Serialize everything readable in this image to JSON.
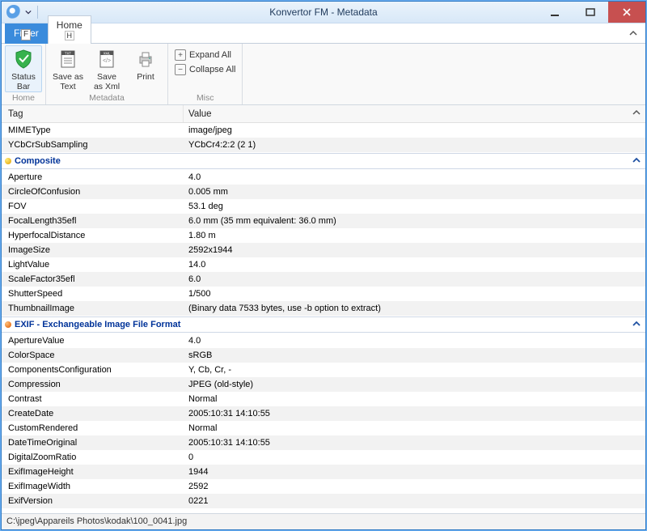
{
  "window": {
    "title": "Konvertor FM - Metadata"
  },
  "ribbon": {
    "tabs": {
      "file": "File",
      "home": "Home",
      "home_key": "H"
    },
    "buttons": {
      "status_bar": "Status\nBar",
      "save_text": "Save as\nText",
      "save_xml": "Save\nas Xml",
      "print": "Print",
      "expand_all": "Expand All",
      "collapse_all": "Collapse All"
    },
    "groups": {
      "home": "Home",
      "metadata": "Metadata",
      "misc": "Misc"
    }
  },
  "grid": {
    "headers": {
      "tag": "Tag",
      "value": "Value"
    },
    "lead_rows": [
      {
        "tag": "MIMEType",
        "value": "image/jpeg"
      },
      {
        "tag": "YCbCrSubSampling",
        "value": "YCbCr4:2:2 (2 1)"
      }
    ],
    "sections": [
      {
        "title": "Composite",
        "icon": "yellow",
        "rows": [
          {
            "tag": "Aperture",
            "value": "4.0"
          },
          {
            "tag": "CircleOfConfusion",
            "value": "0.005 mm"
          },
          {
            "tag": "FOV",
            "value": "53.1 deg"
          },
          {
            "tag": "FocalLength35efl",
            "value": "6.0 mm (35 mm equivalent: 36.0 mm)"
          },
          {
            "tag": "HyperfocalDistance",
            "value": "1.80 m"
          },
          {
            "tag": "ImageSize",
            "value": "2592x1944"
          },
          {
            "tag": "LightValue",
            "value": "14.0"
          },
          {
            "tag": "ScaleFactor35efl",
            "value": "6.0"
          },
          {
            "tag": "ShutterSpeed",
            "value": "1/500"
          },
          {
            "tag": "ThumbnailImage",
            "value": "(Binary data 7533 bytes, use -b option to extract)"
          }
        ]
      },
      {
        "title": "EXIF - Exchangeable Image File Format",
        "icon": "orange",
        "rows": [
          {
            "tag": "ApertureValue",
            "value": "4.0"
          },
          {
            "tag": "ColorSpace",
            "value": "sRGB"
          },
          {
            "tag": "ComponentsConfiguration",
            "value": "Y, Cb, Cr, -"
          },
          {
            "tag": "Compression",
            "value": "JPEG (old-style)"
          },
          {
            "tag": "Contrast",
            "value": "Normal"
          },
          {
            "tag": "CreateDate",
            "value": "2005:10:31 14:10:55"
          },
          {
            "tag": "CustomRendered",
            "value": "Normal"
          },
          {
            "tag": "DateTimeOriginal",
            "value": "2005:10:31 14:10:55"
          },
          {
            "tag": "DigitalZoomRatio",
            "value": "0"
          },
          {
            "tag": "ExifImageHeight",
            "value": "1944"
          },
          {
            "tag": "ExifImageWidth",
            "value": "2592"
          },
          {
            "tag": "ExifVersion",
            "value": "0221"
          }
        ]
      }
    ]
  },
  "statusbar": {
    "path": "C:\\jpeg\\Appareils Photos\\kodak\\100_0041.jpg"
  }
}
